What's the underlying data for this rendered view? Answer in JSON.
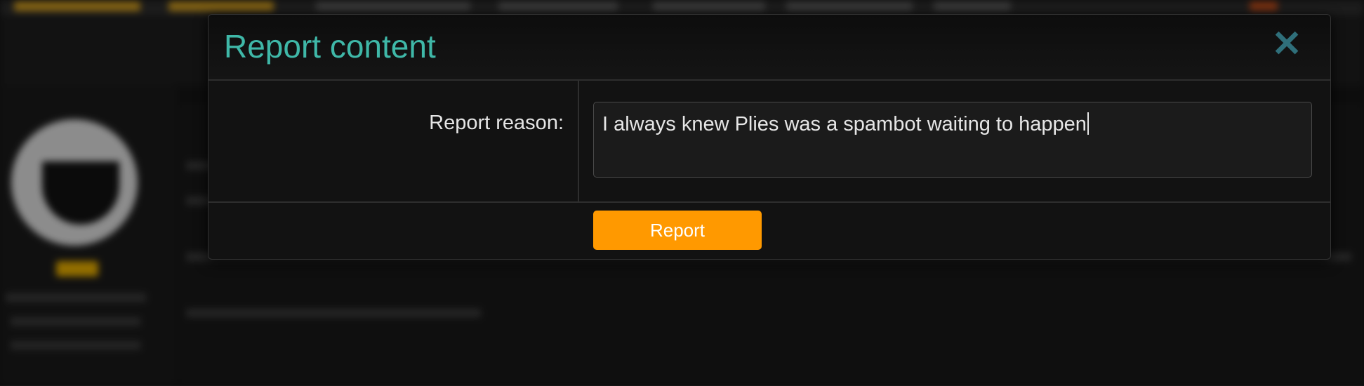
{
  "dialog": {
    "title": "Report content",
    "close_icon": "close-icon",
    "reason_label": "Report reason:",
    "reason_value": "I always knew Plies was a spambot waiting to happen",
    "submit_label": "Report"
  },
  "colors": {
    "title": "#3fb8a8",
    "close": "#2f6f7a",
    "button": "#ff9900",
    "background": "#121212"
  }
}
